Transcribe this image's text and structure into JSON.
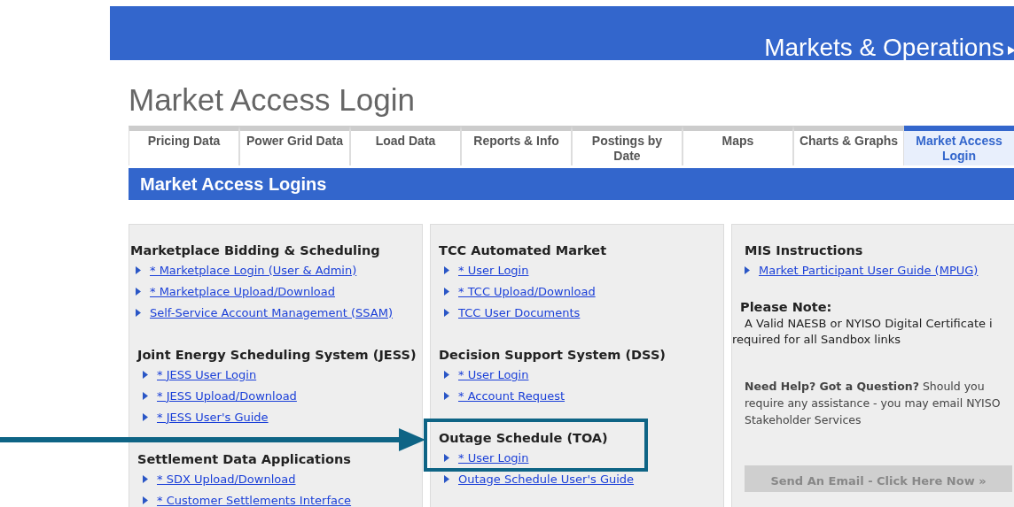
{
  "banner": {
    "title": "Markets & Operations"
  },
  "page_title": "Market Access Login",
  "tabs": [
    {
      "label": "Pricing Data",
      "selected": false
    },
    {
      "label": "Power Grid Data",
      "selected": false
    },
    {
      "label": "Load Data",
      "selected": false
    },
    {
      "label": "Reports & Info",
      "selected": false
    },
    {
      "label": "Postings by Date",
      "selected": false
    },
    {
      "label": "Maps",
      "selected": false
    },
    {
      "label": "Charts & Graphs",
      "selected": false
    },
    {
      "label": "Market Access Login",
      "selected": true
    }
  ],
  "section_bar": {
    "title": "Market Access Logins"
  },
  "columns": [
    {
      "groups": [
        {
          "heading": "Marketplace Bidding & Scheduling",
          "links": [
            "* Marketplace Login (User & Admin)",
            "* Marketplace Upload/Download",
            "Self-Service Account Management (SSAM)"
          ]
        },
        {
          "heading": "Joint Energy Scheduling System (JESS)",
          "links": [
            "* JESS User Login",
            "* JESS Upload/Download",
            "* JESS User's Guide"
          ]
        },
        {
          "heading": "Settlement Data Applications",
          "links": [
            "* SDX Upload/Download",
            "* Customer Settlements Interface"
          ]
        }
      ]
    },
    {
      "groups": [
        {
          "heading": "TCC Automated Market",
          "links": [
            "* User Login",
            "* TCC Upload/Download",
            "TCC User Documents"
          ]
        },
        {
          "heading": "Decision Support System (DSS)",
          "links": [
            "* User Login",
            "* Account Request"
          ]
        },
        {
          "heading": "Outage Schedule (TOA)",
          "links": [
            "* User Login",
            "Outage Schedule User's Guide"
          ]
        }
      ]
    }
  ],
  "instructions": {
    "heading": "MIS Instructions",
    "links": [
      "Market Participant User Guide (MPUG)"
    ]
  },
  "note": {
    "heading": "Please Note:",
    "lines": [
      "A Valid NAESB or NYISO Digital Certificate i",
      "required for all Sandbox links"
    ]
  },
  "help": {
    "text": "**Need Help? Got a Question?** Should you require any assistance - you may email NYISO Stakeholder Services"
  },
  "email_button": {
    "label": "Send An Email - Click Here Now »"
  }
}
